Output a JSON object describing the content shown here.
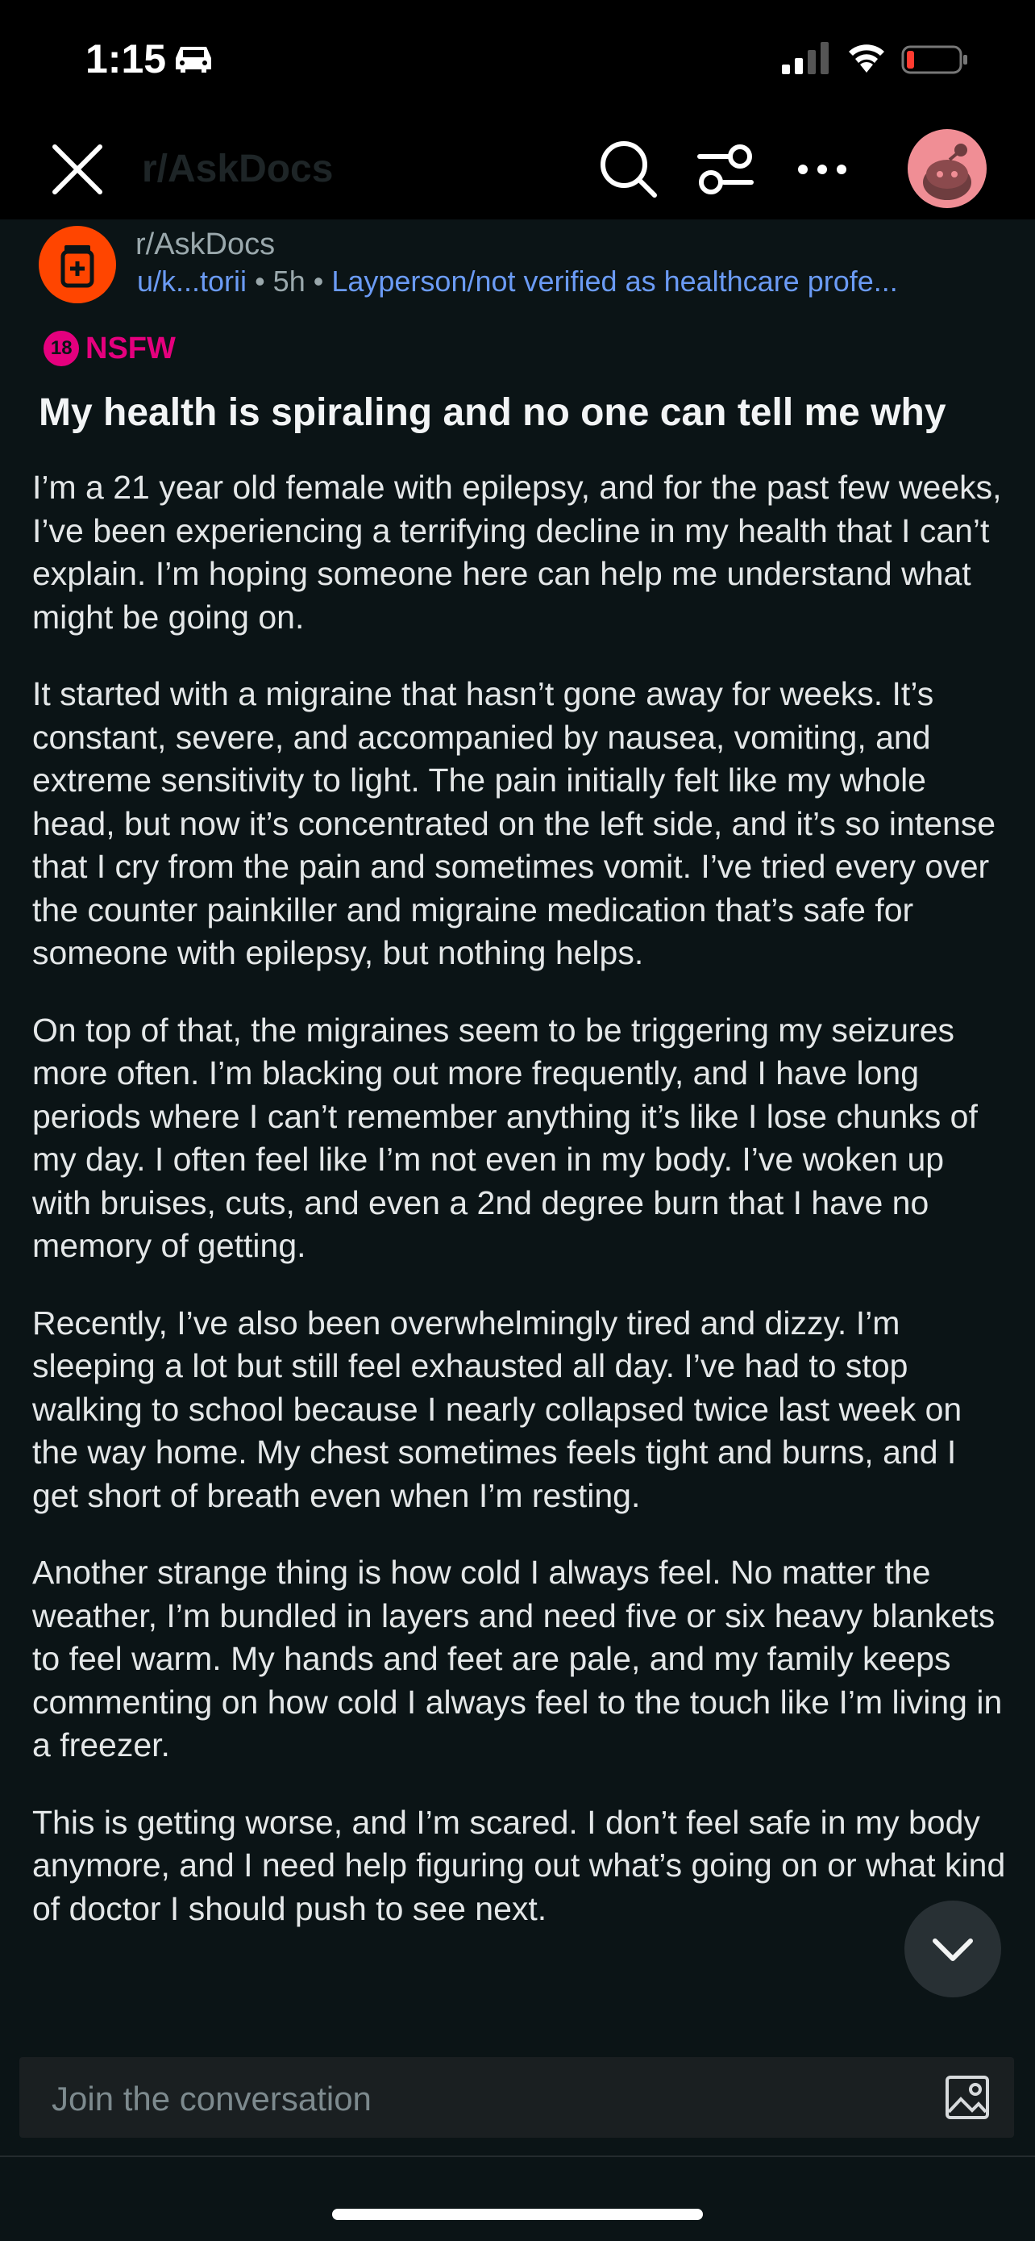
{
  "status_bar": {
    "time": "1:15"
  },
  "nav": {
    "title": "r/AskDocs"
  },
  "post_header": {
    "subreddit": "r/AskDocs",
    "username": "u/k...torii",
    "age": "5h",
    "flair": "Layperson/not verified as healthcare profe..."
  },
  "nsfw": {
    "badge": "18",
    "label": "NSFW"
  },
  "post": {
    "title": "My health is spiraling and no one can tell me why",
    "paragraphs": [
      "I’m a 21 year old female with epilepsy, and for the past few weeks, I’ve been experiencing a terrifying decline in my health that I can’t explain. I’m hoping someone here can help me understand what might be going on.",
      "It started with a migraine that hasn’t gone away for weeks. It’s constant, severe, and accompanied by nausea, vomiting, and extreme sensitivity to light. The pain initially felt like my whole head, but now it’s concentrated on the left side, and it’s so intense that I cry from the pain and sometimes vomit. I’ve tried every over the counter painkiller and migraine medication that’s safe for someone with epilepsy, but nothing helps.",
      "On top of that, the migraines seem to be triggering my seizures more often. I’m blacking out more frequently, and I have long periods where I can’t remember anything  it’s like I lose chunks of my day. I often feel like I’m not even in my body. I’ve woken up with bruises, cuts, and even a 2nd degree burn that I have no memory of getting.",
      "Recently, I’ve also been overwhelmingly tired and dizzy. I’m sleeping a lot but still feel exhausted all day. I’ve had to stop walking to school because I nearly collapsed twice last week on the way home. My chest sometimes feels tight and burns, and I get short of breath even when I’m resting.",
      "Another strange thing is how cold I always feel. No matter the weather, I’m bundled in layers and need five or six heavy blankets to feel warm. My hands and feet are pale, and my family keeps commenting on how cold I always feel to the touch like I’m living in a freezer.",
      "This is getting worse, and I’m scared. I don’t feel safe in my body anymore, and I need help figuring out what’s going on or what kind of doctor I should push to see next."
    ]
  },
  "composer": {
    "placeholder": "Join the conversation"
  },
  "colors": {
    "accent": "#ff4500",
    "nsfw": "#e5007e",
    "link": "#6b9bf5",
    "background": "#0b1416"
  },
  "icons": [
    "car-icon",
    "signal-icon",
    "wifi-icon",
    "battery-icon",
    "close-icon",
    "search-icon",
    "filter-icon",
    "more-icon",
    "snoo-avatar",
    "subreddit-icon",
    "chevron-down-icon",
    "image-icon"
  ]
}
